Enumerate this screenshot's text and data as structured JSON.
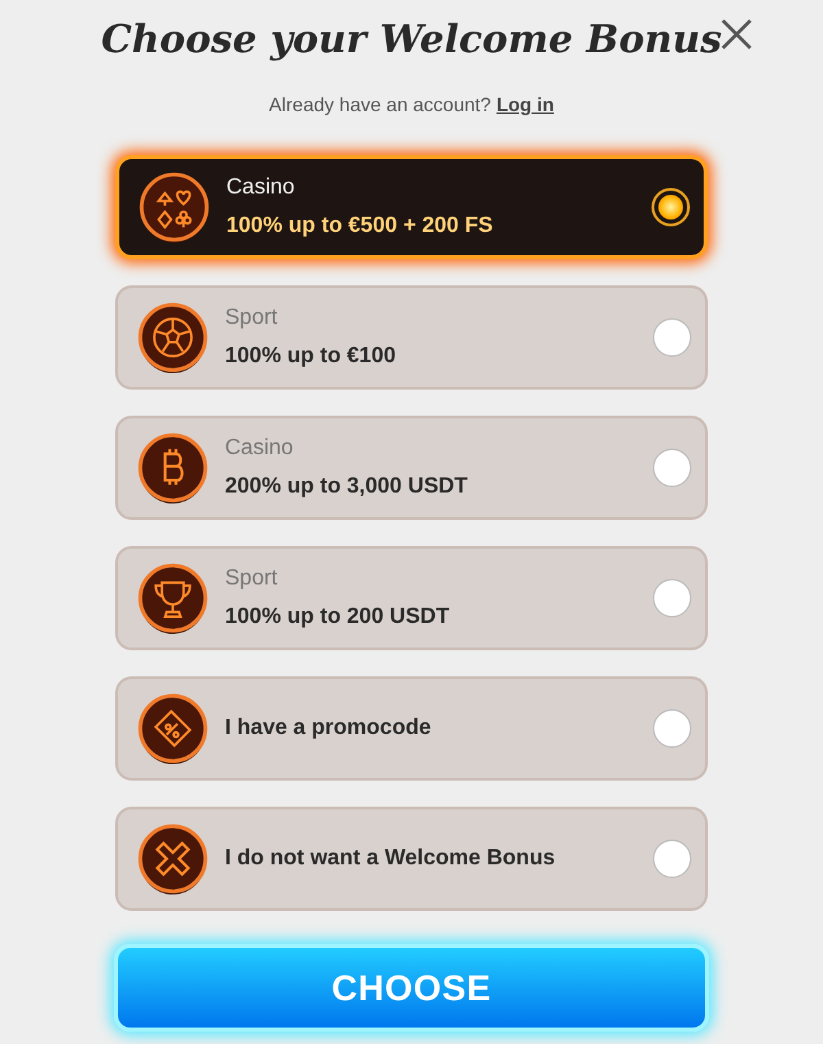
{
  "title": "Choose your Welcome Bonus",
  "account_prompt": {
    "text": "Already have an account?",
    "link": "Log in"
  },
  "options": [
    {
      "kind": "cards",
      "category": "Casino",
      "offer": "100% up to €500 + 200 FS",
      "selected": true
    },
    {
      "kind": "ball",
      "category": "Sport",
      "offer": "100% up to €100",
      "selected": false
    },
    {
      "kind": "bitcoin",
      "category": "Casino",
      "offer": "200% up to 3,000 USDT",
      "selected": false
    },
    {
      "kind": "trophy",
      "category": "Sport",
      "offer": "100% up to 200 USDT",
      "selected": false
    },
    {
      "kind": "ticket",
      "offer": "I have a promocode",
      "selected": false
    },
    {
      "kind": "cross",
      "offer": "I do not want a Welcome Bonus",
      "selected": false
    }
  ],
  "button": "CHOOSE"
}
